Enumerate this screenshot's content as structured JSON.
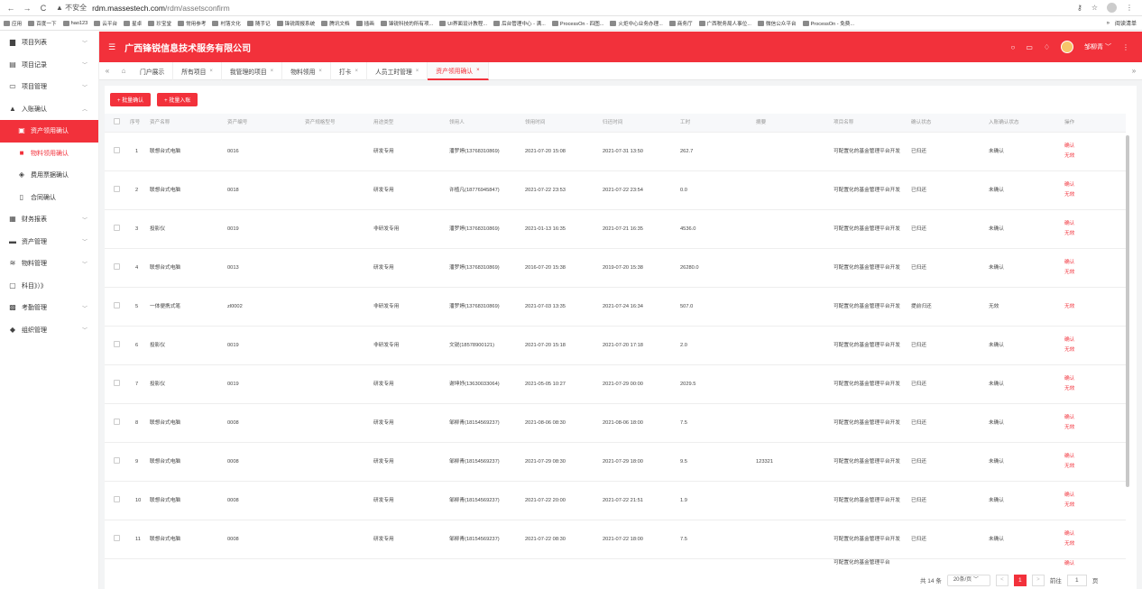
{
  "browser": {
    "security": "不安全",
    "url_host": "rdm.massestech.com",
    "url_path": "/rdm/assetsconfirm",
    "profile_label": "",
    "bookmarks": [
      "应用",
      "百度一下",
      "hao123",
      "云平台",
      "星卓",
      "珍宝堂",
      "常用参考",
      "村落文化",
      "随手记",
      "锋锐周报系统",
      "腾讯文档",
      "插画",
      "锋锐科技的所有项...",
      "UI界面设计教程...",
      "后台管理中心 - 满...",
      "ProcessOn - 四图...",
      "火炬中心业务办理...",
      "商务厅",
      "广西税务局人事位...",
      "微信公众平台",
      "ProcessOn - 免费..."
    ],
    "bookmarks_more": "»",
    "reading_list": "阅读清单"
  },
  "sidebar": {
    "items": [
      {
        "label": "项目列表",
        "icon": "folder-icon",
        "chevron": "﹀",
        "type": "top"
      },
      {
        "label": "项目记录",
        "icon": "list-icon",
        "chevron": "﹀",
        "type": "top"
      },
      {
        "label": "项目管理",
        "icon": "window-icon",
        "chevron": "﹀",
        "type": "top"
      },
      {
        "label": "入账确认",
        "icon": "person-icon",
        "chevron": "︿",
        "type": "top"
      },
      {
        "label": "资产领用确认",
        "icon": "card-icon",
        "chevron": "",
        "type": "active"
      },
      {
        "label": "物料领用确认",
        "icon": "truck-icon",
        "chevron": "",
        "type": "sub-red"
      },
      {
        "label": "费用票据确认",
        "icon": "layers-icon",
        "chevron": "",
        "type": "sub"
      },
      {
        "label": "合同确认",
        "icon": "doc-icon",
        "chevron": "",
        "type": "sub"
      },
      {
        "label": "财务报表",
        "icon": "report-icon",
        "chevron": "﹀",
        "type": "top"
      },
      {
        "label": "资产管理",
        "icon": "briefcase-icon",
        "chevron": "﹀",
        "type": "top"
      },
      {
        "label": "物料管理",
        "icon": "stack-icon",
        "chevron": "﹀",
        "type": "top"
      },
      {
        "label": "科目》）》",
        "icon": "grid-icon",
        "chevron": "",
        "type": "top"
      },
      {
        "label": "考勤管理",
        "icon": "calendar-icon",
        "chevron": "﹀",
        "type": "top"
      },
      {
        "label": "组织管理",
        "icon": "group-icon",
        "chevron": "﹀",
        "type": "top"
      }
    ]
  },
  "header": {
    "title": "广西锋锐信息技术服务有限公司",
    "user": "邹柳青"
  },
  "tabs": [
    {
      "label": "门户展示",
      "closable": false,
      "active": false
    },
    {
      "label": "所有项目",
      "closable": true,
      "active": false
    },
    {
      "label": "我管理的项目",
      "closable": true,
      "active": false
    },
    {
      "label": "物料领用",
      "closable": true,
      "active": false
    },
    {
      "label": "打卡",
      "closable": true,
      "active": false
    },
    {
      "label": "人员工时管理",
      "closable": true,
      "active": false
    },
    {
      "label": "资产领用确认",
      "closable": true,
      "active": true
    }
  ],
  "toolbar": {
    "batch_confirm": "+ 批量确认",
    "batch_entry": "+ 批量入账"
  },
  "table": {
    "columns": [
      "",
      "序号",
      "资产名称",
      "资产编号",
      "资产规格型号",
      "用途类型",
      "领用人",
      "领用时间",
      "归还时间",
      "工时",
      "摘要",
      "项目名称",
      "确认状态",
      "入账确认状态",
      "操作"
    ],
    "rows": [
      {
        "no": "1",
        "name": "联想台式电脑",
        "code": "0016",
        "spec": "",
        "use": "研发专用",
        "person": "潘罗婷(13768310869)",
        "start": "2021-07-20 15:08",
        "end": "2021-07-31 13:50",
        "hours": "262.7",
        "summary": "",
        "project": "可配置化的基金管理平台开发",
        "status": "已归还",
        "entry": "未确认",
        "a1": "确认",
        "a2": "无效"
      },
      {
        "no": "2",
        "name": "联想台式电脑",
        "code": "0018",
        "spec": "",
        "use": "研发专用",
        "person": "许植凡(18776945847)",
        "start": "2021-07-22 23:53",
        "end": "2021-07-22 23:54",
        "hours": "0.0",
        "summary": "",
        "project": "可配置化的基金管理平台开发",
        "status": "已归还",
        "entry": "未确认",
        "a1": "确认",
        "a2": "无效"
      },
      {
        "no": "3",
        "name": "投影仪",
        "code": "0019",
        "spec": "",
        "use": "非研发专用",
        "person": "潘罗婷(13768310869)",
        "start": "2021-01-13 16:35",
        "end": "2021-07-21 16:35",
        "hours": "4536.0",
        "summary": "",
        "project": "可配置化的基金管理平台开发",
        "status": "已归还",
        "entry": "未确认",
        "a1": "确认",
        "a2": "无效"
      },
      {
        "no": "4",
        "name": "联想台式电脑",
        "code": "0013",
        "spec": "",
        "use": "研发专用",
        "person": "潘罗婷(13768310869)",
        "start": "2016-07-20 15:38",
        "end": "2019-07-20 15:38",
        "hours": "26280.0",
        "summary": "",
        "project": "可配置化的基金管理平台开发",
        "status": "已归还",
        "entry": "未确认",
        "a1": "确认",
        "a2": "无效"
      },
      {
        "no": "5",
        "name": "一体便携式笔",
        "code": "zl0002",
        "spec": "",
        "use": "非研发专用",
        "person": "潘罗婷(13768310869)",
        "start": "2021-07-03 13:35",
        "end": "2021-07-24 16:34",
        "hours": "507.0",
        "summary": "",
        "project": "可配置化的基金管理平台开发",
        "status": "提前归还",
        "entry": "无效",
        "a1": "",
        "a2": "无效"
      },
      {
        "no": "6",
        "name": "投影仪",
        "code": "0019",
        "spec": "",
        "use": "非研发专用",
        "person": "文锐(18578900121)",
        "start": "2021-07-20 15:18",
        "end": "2021-07-20 17:18",
        "hours": "2.0",
        "summary": "",
        "project": "可配置化的基金管理平台开发",
        "status": "已归还",
        "entry": "未确认",
        "a1": "确认",
        "a2": "无效"
      },
      {
        "no": "7",
        "name": "投影仪",
        "code": "0019",
        "spec": "",
        "use": "研发专用",
        "person": "谢坤妤(13630033064)",
        "start": "2021-05-05 10:27",
        "end": "2021-07-29 00:00",
        "hours": "2029.5",
        "summary": "",
        "project": "可配置化的基金管理平台开发",
        "status": "已归还",
        "entry": "未确认",
        "a1": "确认",
        "a2": "无效"
      },
      {
        "no": "8",
        "name": "联想台式电脑",
        "code": "0008",
        "spec": "",
        "use": "研发专用",
        "person": "邹柳青(18154569237)",
        "start": "2021-08-06 08:30",
        "end": "2021-08-06 18:00",
        "hours": "7.5",
        "summary": "",
        "project": "可配置化的基金管理平台开发",
        "status": "已归还",
        "entry": "未确认",
        "a1": "确认",
        "a2": "无效"
      },
      {
        "no": "9",
        "name": "联想台式电脑",
        "code": "0008",
        "spec": "",
        "use": "研发专用",
        "person": "邹柳青(18154569237)",
        "start": "2021-07-29 08:30",
        "end": "2021-07-29 18:00",
        "hours": "9.5",
        "summary": "123321",
        "project": "可配置化的基金管理平台开发",
        "status": "已归还",
        "entry": "未确认",
        "a1": "确认",
        "a2": "无效"
      },
      {
        "no": "10",
        "name": "联想台式电脑",
        "code": "0008",
        "spec": "",
        "use": "研发专用",
        "person": "邹柳青(18154569237)",
        "start": "2021-07-22 20:00",
        "end": "2021-07-22 21:51",
        "hours": "1.9",
        "summary": "",
        "project": "可配置化的基金管理平台开发",
        "status": "已归还",
        "entry": "未确认",
        "a1": "确认",
        "a2": "无效"
      },
      {
        "no": "11",
        "name": "联想台式电脑",
        "code": "0008",
        "spec": "",
        "use": "研发专用",
        "person": "邹柳青(18154569237)",
        "start": "2021-07-22 08:30",
        "end": "2021-07-22 18:00",
        "hours": "7.5",
        "summary": "",
        "project": "可配置化的基金管理平台开发",
        "status": "已归还",
        "entry": "未确认",
        "a1": "确认",
        "a2": "无效"
      }
    ],
    "partial_row": {
      "project": "可配置化的基金管理平台",
      "a1": "确认"
    }
  },
  "pager": {
    "total": "共 14 条",
    "page_size": "20条/页",
    "prev": "<",
    "current": "1",
    "next": ">",
    "jump_label": "前往",
    "jump_value": "1",
    "jump_suffix": "页"
  },
  "colors": {
    "brand": "#f2313b"
  }
}
